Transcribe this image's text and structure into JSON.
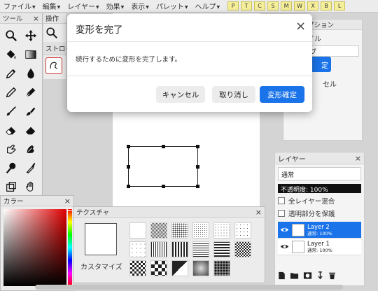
{
  "menu": {
    "items": [
      "ファイル",
      "編集",
      "レイヤー",
      "効果",
      "表示",
      "パレット",
      "ヘルプ"
    ],
    "quick_buttons": [
      "P",
      "T",
      "C",
      "S",
      "M",
      "W",
      "X",
      "B",
      "L"
    ]
  },
  "tools_panel": {
    "title": "ツール",
    "close": "×"
  },
  "operation_panel": {
    "title": "操作",
    "stroke_label": "ストローク"
  },
  "options_panel": {
    "title": "プション",
    "label": "イル",
    "input_value": "ブ",
    "confirm": "定",
    "cancel": "セル"
  },
  "layers_panel": {
    "title": "レイヤー",
    "close": "×",
    "blend_mode": "通常",
    "opacity": "不透明度: 100%",
    "merge_all": "全レイヤー混合",
    "protect_alpha": "透明部分を保護",
    "layers": [
      {
        "name": "Layer 2",
        "mode": "通常: 100%",
        "active": true
      },
      {
        "name": "Layer 1",
        "mode": "通常: 100%",
        "active": false
      }
    ]
  },
  "color_panel": {
    "title": "カラー",
    "close": "×",
    "hue_color": "#e00000"
  },
  "texture_panel": {
    "title": "テクスチャ",
    "close": "×",
    "customize": "カスタマイズ"
  },
  "modal": {
    "title": "変形を完了",
    "close": "×",
    "message": "続行するために変形を完了します。",
    "cancel": "キャンセル",
    "undo": "取り消し",
    "confirm": "変形確定"
  },
  "colors": {
    "accent": "#1a73e8",
    "quick_bg": "#f6ef9a"
  }
}
